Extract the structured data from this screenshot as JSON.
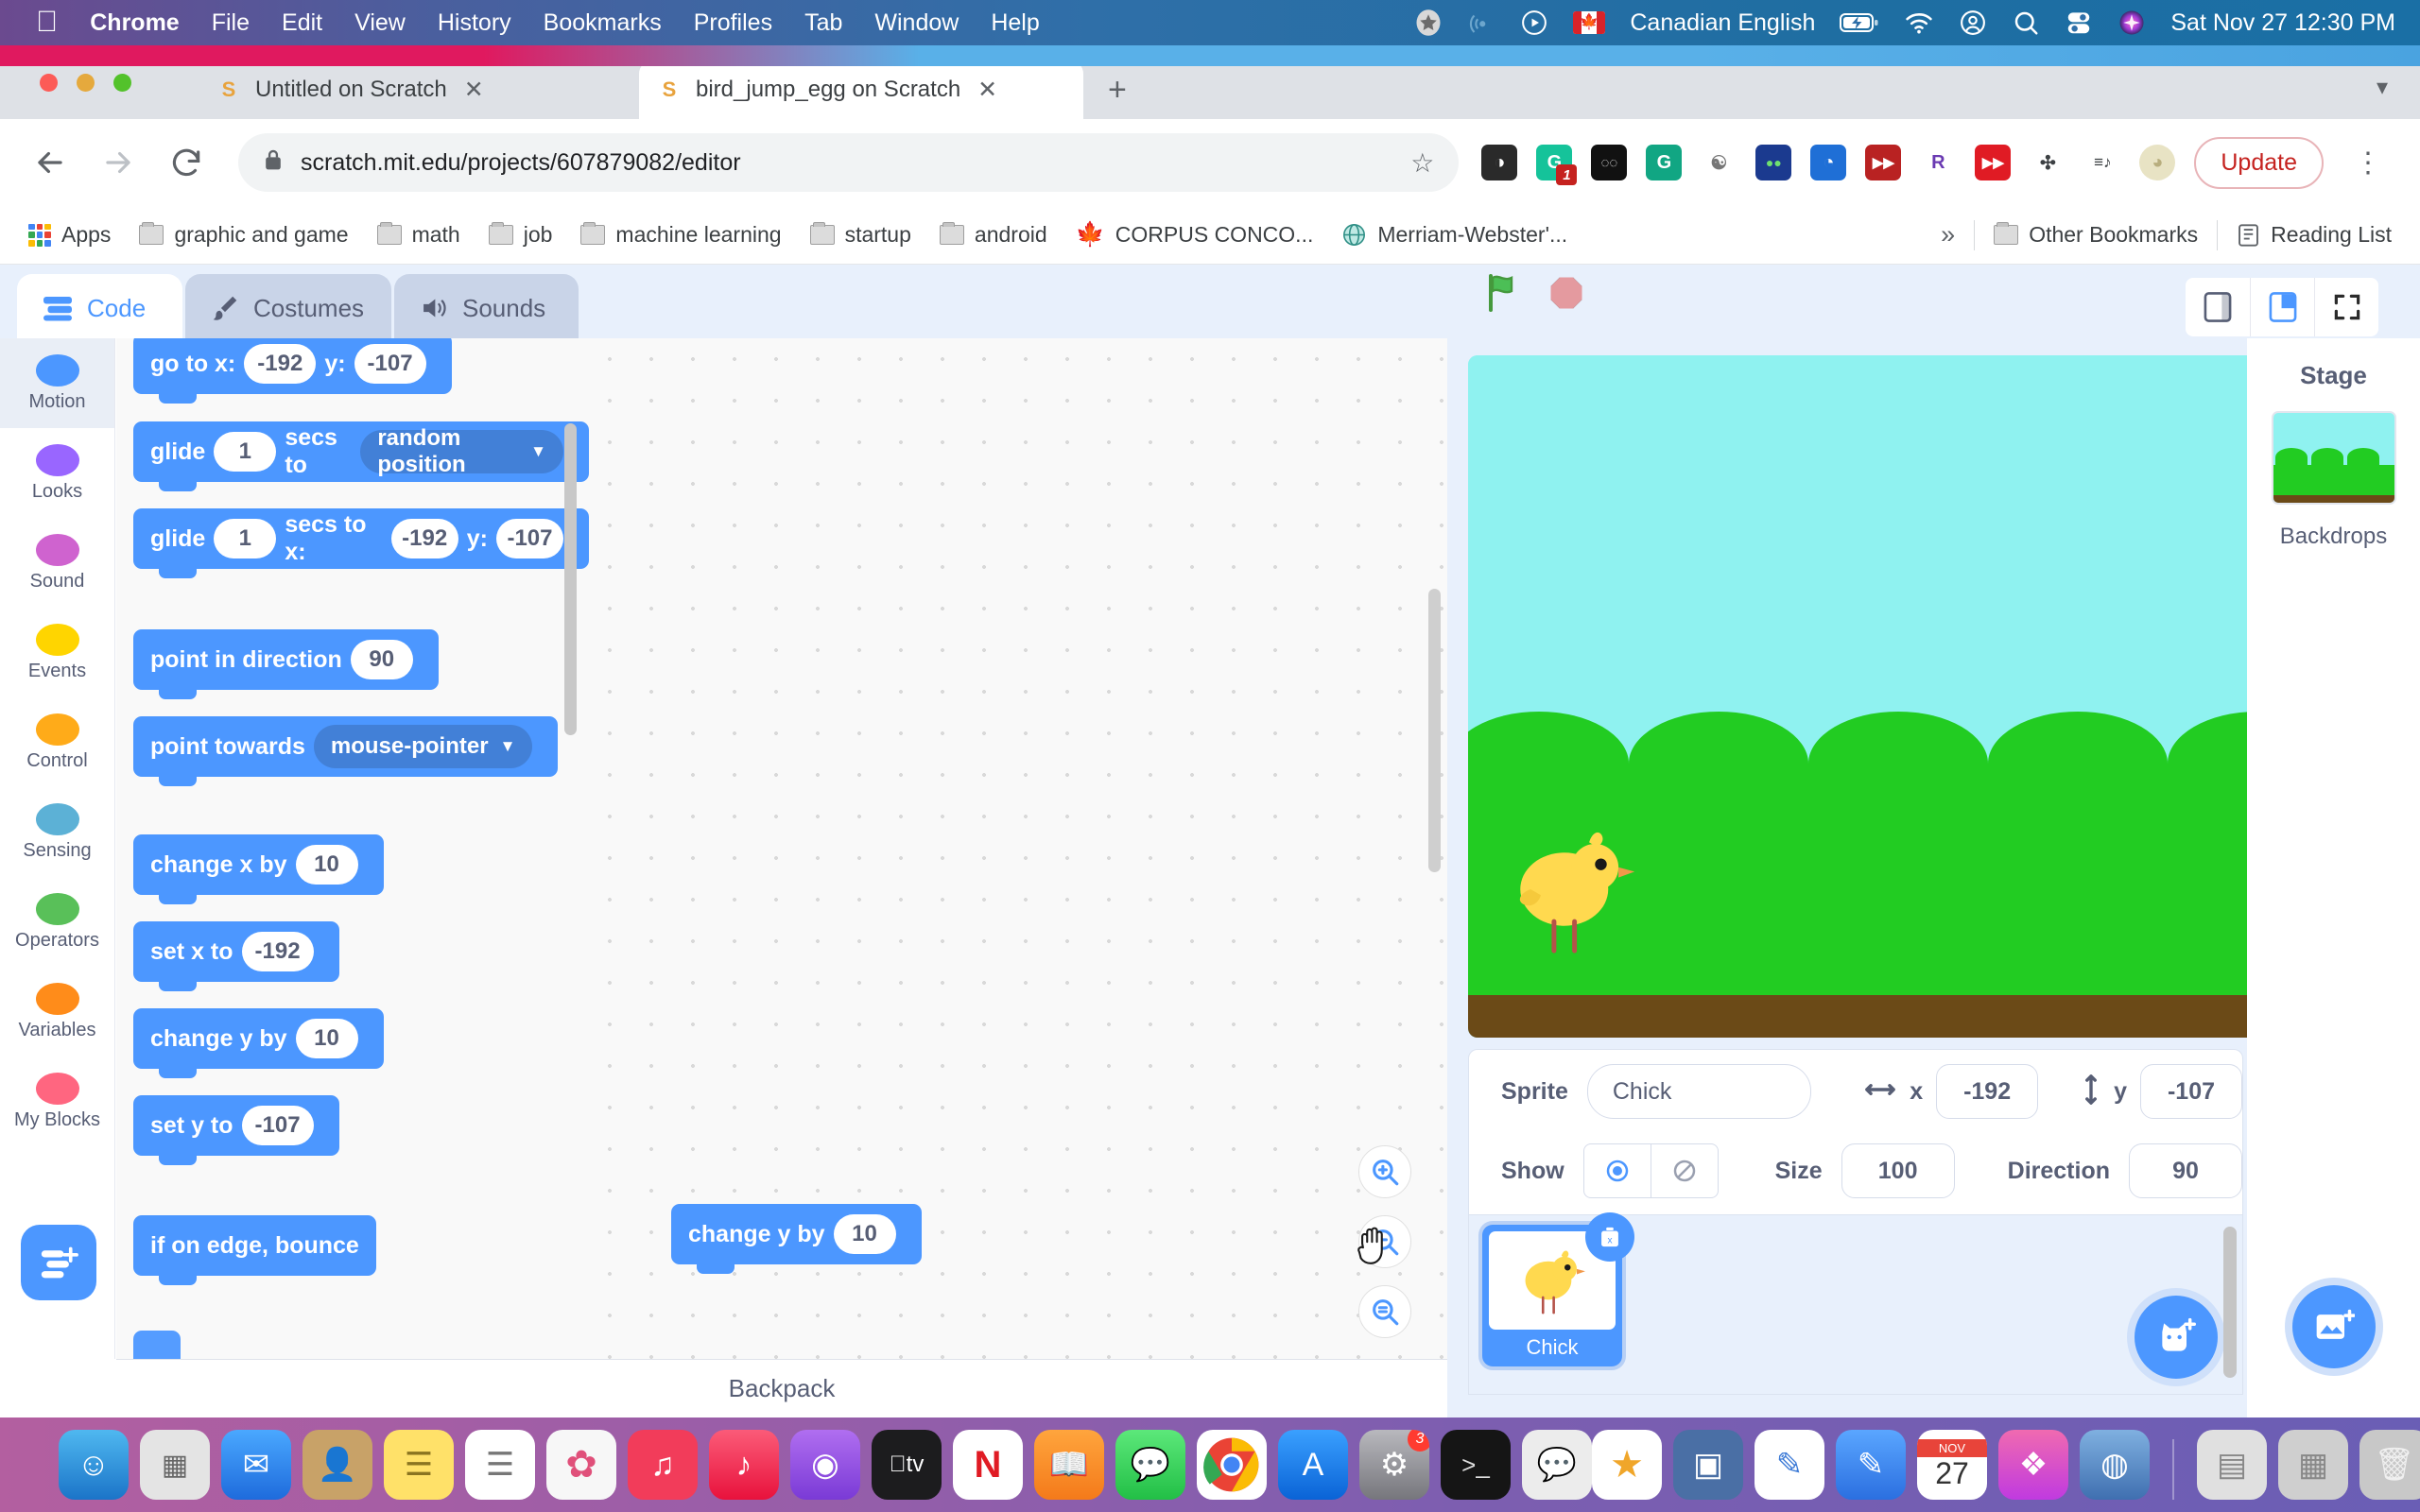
{
  "menubar": {
    "apple_icon": "apple-logo",
    "items": [
      {
        "label": "Chrome",
        "bold": true
      },
      {
        "label": "File",
        "bold": false
      },
      {
        "label": "Edit",
        "bold": false
      },
      {
        "label": "View",
        "bold": false
      },
      {
        "label": "History",
        "bold": false
      },
      {
        "label": "Bookmarks",
        "bold": false
      },
      {
        "label": "Profiles",
        "bold": false
      },
      {
        "label": "Tab",
        "bold": false
      },
      {
        "label": "Window",
        "bold": false
      },
      {
        "label": "Help",
        "bold": false
      }
    ],
    "status": {
      "star_icon": "star-badge-icon",
      "cast_icon": "airplay-audio-icon",
      "play_icon": "now-playing-icon",
      "input_flag": "canada-flag-icon",
      "input_language": "Canadian English",
      "battery_icon": "battery-charging-icon",
      "wifi_icon": "wifi-icon",
      "control_center_icon": "control-center-icon",
      "account_icon": "user-account-icon",
      "search_icon": "spotlight-search-icon",
      "siri_icon": "siri-icon",
      "datetime": "Sat Nov 27  12:30 PM"
    }
  },
  "browser": {
    "tabs": [
      {
        "title": "Untitled on Scratch",
        "active": false,
        "favicon": "scratch-favicon",
        "close_icon": "close-icon"
      },
      {
        "title": "bird_jump_egg on Scratch",
        "active": true,
        "favicon": "scratch-favicon",
        "close_icon": "close-icon"
      }
    ],
    "new_tab_icon": "plus-icon",
    "window_caret_icon": "chevron-down-icon",
    "nav": {
      "back_icon": "back-arrow-icon",
      "forward_icon": "forward-arrow-icon",
      "reload_icon": "reload-icon"
    },
    "omnibox": {
      "lock_icon": "lock-icon",
      "url": "scratch.mit.edu/projects/607879082/editor",
      "bookmark_star_icon": "star-outline-icon"
    },
    "extensions": [
      {
        "name": "zoom-extension",
        "glyph": "◑",
        "bg": "#2a2a2a",
        "badge": ""
      },
      {
        "name": "grammarly-extension",
        "glyph": "G",
        "bg": "#15c39a",
        "badge": "1"
      },
      {
        "name": "dark-reader-extension",
        "glyph": "◖◗",
        "bg": "#111111",
        "badge": ""
      },
      {
        "name": "grammarly-green-extension",
        "glyph": "G",
        "bg": "#11a683",
        "badge": ""
      },
      {
        "name": "paw-extension",
        "glyph": "🐾",
        "bg": "#ffffff",
        "badge": ""
      },
      {
        "name": "colorblind-extension",
        "glyph": "◉◉",
        "bg": "#1b3a8f",
        "badge": ""
      },
      {
        "name": "clock-extension",
        "glyph": "◔",
        "bg": "#1f6fd6",
        "badge": ""
      },
      {
        "name": "fastforward-red-extension",
        "glyph": "▶▶",
        "bg": "#b92222",
        "badge": ""
      },
      {
        "name": "rakuten-extension",
        "glyph": "R",
        "bg": "#ffffff",
        "badge": ""
      },
      {
        "name": "video-speed-extension",
        "glyph": "▶▶",
        "bg": "#e01b24",
        "badge": ""
      },
      {
        "name": "puzzle-extensions-icon",
        "glyph": "🧩",
        "bg": "#ffffff",
        "badge": ""
      },
      {
        "name": "reading-queue-icon",
        "glyph": "≡♪",
        "bg": "#ffffff",
        "badge": ""
      },
      {
        "name": "profile-avatar",
        "glyph": "◕",
        "bg": "#e8e3c4",
        "badge": ""
      }
    ],
    "update_label": "Update",
    "kebab_icon": "more-vertical-icon",
    "bookmarks": [
      {
        "label": "Apps",
        "icon": "apps-grid-icon"
      },
      {
        "label": "graphic and game",
        "icon": "folder-icon"
      },
      {
        "label": "math",
        "icon": "folder-icon"
      },
      {
        "label": "job",
        "icon": "folder-icon"
      },
      {
        "label": "machine learning",
        "icon": "folder-icon"
      },
      {
        "label": "startup",
        "icon": "folder-icon"
      },
      {
        "label": "android",
        "icon": "folder-icon"
      },
      {
        "label": "CORPUS CONCO...",
        "icon": "maple-leaf-icon"
      },
      {
        "label": "Merriam-Webster'...",
        "icon": "globe-icon"
      }
    ],
    "overflow_label": "»",
    "other_bookmarks": "Other Bookmarks",
    "reading_list": "Reading List"
  },
  "scratch": {
    "tabs": [
      {
        "label": "Code",
        "icon": "code-blocks-icon",
        "active": true
      },
      {
        "label": "Costumes",
        "icon": "paintbrush-icon",
        "active": false
      },
      {
        "label": "Sounds",
        "icon": "speaker-icon",
        "active": false
      }
    ],
    "controls": {
      "green_flag_icon": "green-flag-icon",
      "stop_icon": "stop-sign-icon"
    },
    "stage_size_buttons": [
      {
        "name": "small-stage-button",
        "active": false
      },
      {
        "name": "large-stage-button",
        "active": true
      },
      {
        "name": "fullscreen-stage-button",
        "active": false
      }
    ],
    "categories": [
      {
        "label": "Motion",
        "color": "#4c97ff",
        "selected": true
      },
      {
        "label": "Looks",
        "color": "#9966ff",
        "selected": false
      },
      {
        "label": "Sound",
        "color": "#cf63cf",
        "selected": false
      },
      {
        "label": "Events",
        "color": "#ffd500",
        "selected": false
      },
      {
        "label": "Control",
        "color": "#ffab19",
        "selected": false
      },
      {
        "label": "Sensing",
        "color": "#5cb1d6",
        "selected": false
      },
      {
        "label": "Operators",
        "color": "#59c059",
        "selected": false
      },
      {
        "label": "Variables",
        "color": "#ff8c1a",
        "selected": false
      },
      {
        "label": "My Blocks",
        "color": "#ff6680",
        "selected": false
      }
    ],
    "add_extension_icon": "add-extension-icon",
    "palette_blocks": [
      {
        "name": "go-to-xy-block",
        "parts": [
          {
            "t": "text",
            "v": "go to x:"
          },
          {
            "t": "oval",
            "v": "-192"
          },
          {
            "t": "text",
            "v": "y:"
          },
          {
            "t": "oval",
            "v": "-107"
          }
        ]
      },
      {
        "name": "glide-secs-to-block",
        "parts": [
          {
            "t": "text",
            "v": "glide"
          },
          {
            "t": "oval",
            "v": "1"
          },
          {
            "t": "text",
            "v": "secs to"
          },
          {
            "t": "drop",
            "v": "random position"
          }
        ]
      },
      {
        "name": "glide-secs-to-xy-block",
        "parts": [
          {
            "t": "text",
            "v": "glide"
          },
          {
            "t": "oval",
            "v": "1"
          },
          {
            "t": "text",
            "v": "secs to x:"
          },
          {
            "t": "oval",
            "v": "-192"
          },
          {
            "t": "text",
            "v": "y:"
          },
          {
            "t": "oval",
            "v": "-107"
          }
        ]
      },
      {
        "name": "point-in-direction-block",
        "parts": [
          {
            "t": "text",
            "v": "point in direction"
          },
          {
            "t": "oval",
            "v": "90"
          }
        ]
      },
      {
        "name": "point-towards-block",
        "parts": [
          {
            "t": "text",
            "v": "point towards"
          },
          {
            "t": "drop",
            "v": "mouse-pointer"
          }
        ]
      },
      {
        "name": "change-x-by-block",
        "parts": [
          {
            "t": "text",
            "v": "change x by"
          },
          {
            "t": "oval",
            "v": "10"
          }
        ]
      },
      {
        "name": "set-x-to-block",
        "parts": [
          {
            "t": "text",
            "v": "set x to"
          },
          {
            "t": "oval",
            "v": "-192"
          }
        ]
      },
      {
        "name": "change-y-by-block",
        "parts": [
          {
            "t": "text",
            "v": "change y by"
          },
          {
            "t": "oval",
            "v": "10"
          }
        ]
      },
      {
        "name": "set-y-to-block",
        "parts": [
          {
            "t": "text",
            "v": "set y to"
          },
          {
            "t": "oval",
            "v": "-107"
          }
        ]
      },
      {
        "name": "if-on-edge-bounce-block",
        "parts": [
          {
            "t": "text",
            "v": "if on edge, bounce"
          }
        ]
      }
    ],
    "workspace_block": {
      "name": "change-y-by-block-dragged",
      "label": "change y by",
      "value": "10"
    },
    "cursor_icon": "grab-hand-cursor",
    "zoom_buttons": [
      {
        "name": "zoom-in-button",
        "glyph": "+"
      },
      {
        "name": "zoom-out-button",
        "glyph": "−"
      },
      {
        "name": "zoom-reset-button",
        "glyph": "="
      }
    ],
    "backpack_label": "Backpack",
    "sprite_info": {
      "sprite_label": "Sprite",
      "sprite_name": "Chick",
      "x_label": "x",
      "x_value": "-192",
      "y_label": "y",
      "y_value": "-107",
      "x_icon": "horizontal-arrows-icon",
      "y_icon": "vertical-arrows-icon",
      "show_label": "Show",
      "show_on_icon": "eye-visible-icon",
      "show_off_icon": "eye-hidden-icon",
      "size_label": "Size",
      "size_value": "100",
      "direction_label": "Direction",
      "direction_value": "90"
    },
    "sprites": [
      {
        "name": "Chick",
        "selected": true,
        "delete_icon": "delete-trash-icon"
      }
    ],
    "add_sprite_icon": "add-sprite-cat-icon",
    "stage_panel": {
      "header": "Stage",
      "backdrops_label": "Backdrops",
      "add_backdrop_icon": "add-backdrop-icon"
    }
  },
  "dock": {
    "left_items": [
      {
        "name": "finder-dock-icon",
        "glyph": "🙂",
        "bg": "#2b8fe0",
        "badge": ""
      },
      {
        "name": "launchpad-dock-icon",
        "glyph": "⠿",
        "bg": "#dcdcdc",
        "badge": ""
      },
      {
        "name": "mail-dock-icon",
        "glyph": "✉",
        "bg": "#2f7ef0",
        "badge": ""
      },
      {
        "name": "contacts-dock-icon",
        "glyph": "👤",
        "bg": "#c8a268",
        "badge": ""
      },
      {
        "name": "notes-dock-icon",
        "glyph": "▤",
        "bg": "#ffe169",
        "badge": ""
      },
      {
        "name": "reminders-dock-icon",
        "glyph": "☰",
        "bg": "#ffffff",
        "badge": ""
      },
      {
        "name": "photos-dock-icon",
        "glyph": "❀",
        "bg": "#f6f6f6",
        "badge": ""
      },
      {
        "name": "itunes-dock-icon",
        "glyph": "♫",
        "bg": "#f23c5a",
        "badge": ""
      },
      {
        "name": "music-dock-icon",
        "glyph": "♪",
        "bg": "#fb2b54",
        "badge": ""
      },
      {
        "name": "podcasts-dock-icon",
        "glyph": "◉",
        "bg": "#9b5de5",
        "badge": ""
      },
      {
        "name": "appletv-dock-icon",
        "glyph": "tv",
        "bg": "#1c1c1e",
        "badge": ""
      },
      {
        "name": "news-dock-icon",
        "glyph": "N",
        "bg": "#ffffff",
        "badge": ""
      },
      {
        "name": "books-dock-icon",
        "glyph": "📖",
        "bg": "#ff8a1e",
        "badge": ""
      },
      {
        "name": "messages-dock-icon",
        "glyph": "💬",
        "bg": "#3ed058",
        "badge": ""
      },
      {
        "name": "chrome-dock-icon",
        "glyph": "◎",
        "bg": "#ffffff",
        "badge": ""
      },
      {
        "name": "appstore-dock-icon",
        "glyph": "A",
        "bg": "#1d8df5",
        "badge": ""
      },
      {
        "name": "settings-dock-icon",
        "glyph": "⚙",
        "bg": "#8e8e93",
        "badge": "3"
      },
      {
        "name": "terminal-dock-icon",
        "glyph": ">_",
        "bg": "#1c1c1e",
        "badge": ""
      },
      {
        "name": "wechat-dock-icon",
        "glyph": "💬",
        "bg": "#e8e8e8",
        "badge": ""
      }
    ],
    "right_items": [
      {
        "name": "keynote-dock-icon",
        "glyph": "★",
        "bg": "#ffffff",
        "badge": ""
      },
      {
        "name": "screens-dock-icon",
        "glyph": "▣",
        "bg": "#4a6fa5",
        "badge": ""
      },
      {
        "name": "sketch-dock-icon",
        "glyph": "✎",
        "bg": "#ffffff",
        "badge": ""
      },
      {
        "name": "pencil-dock-icon",
        "glyph": "✏",
        "bg": "#3d8bf0",
        "badge": ""
      },
      {
        "name": "calendar-dock-icon",
        "glyph": "27",
        "bg": "#ffffff",
        "badge": ""
      },
      {
        "name": "shortcuts-dock-icon",
        "glyph": "❖",
        "bg": "#f05a8c",
        "badge": ""
      },
      {
        "name": "browser-dock-icon",
        "glyph": "◍",
        "bg": "#5a8fd6",
        "badge": ""
      },
      {
        "name": "downloads-stack-icon",
        "glyph": "▤",
        "bg": "#d8d8d8",
        "badge": ""
      },
      {
        "name": "documents-stack-icon",
        "glyph": "▦",
        "bg": "#cfcfcf",
        "badge": ""
      },
      {
        "name": "trash-dock-icon",
        "glyph": "🗑",
        "bg": "#d0d0d0",
        "badge": ""
      }
    ],
    "calendar_month": "NOV",
    "calendar_day": "27"
  }
}
